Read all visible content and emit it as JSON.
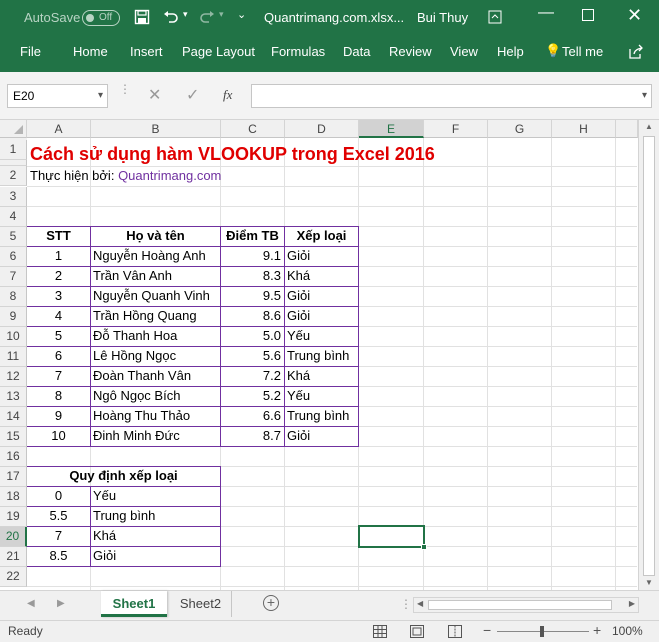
{
  "titlebar": {
    "autosave_label": "AutoSave",
    "autosave_state": "Off",
    "filename": "Quantrimang.com.xlsx...",
    "user": "Bui Thuy"
  },
  "ribbon": {
    "tabs": [
      "File",
      "Home",
      "Insert",
      "Page Layout",
      "Formulas",
      "Data",
      "Review",
      "View",
      "Help",
      "Tell me"
    ]
  },
  "formula_bar": {
    "name_box": "E20",
    "formula": "",
    "fx": "fx"
  },
  "columns": [
    "A",
    "B",
    "C",
    "D",
    "E",
    "F",
    "G",
    "H"
  ],
  "rows": [
    "1",
    "2",
    "3",
    "4",
    "5",
    "6",
    "7",
    "8",
    "9",
    "10",
    "11",
    "12",
    "13",
    "14",
    "15",
    "16",
    "17",
    "18",
    "19",
    "20",
    "21",
    "22"
  ],
  "sheet": {
    "title": "Cách sử dụng hàm VLOOKUP trong Excel 2016",
    "byline_label": "Thực hiện bởi:",
    "byline_link": "Quantrimang.com",
    "table_headers": [
      "STT",
      "Họ và tên",
      "Điểm TB",
      "Xếp loại"
    ],
    "table_rows": [
      [
        "1",
        "Nguyễn Hoàng Anh",
        "9.1",
        "Giỏi"
      ],
      [
        "2",
        "Trần Vân Anh",
        "8.3",
        "Khá"
      ],
      [
        "3",
        "Nguyễn Quanh Vinh",
        "9.5",
        "Giỏi"
      ],
      [
        "4",
        "Trần Hồng Quang",
        "8.6",
        "Giỏi"
      ],
      [
        "5",
        "Đỗ Thanh Hoa",
        "5.0",
        "Yếu"
      ],
      [
        "6",
        "Lê Hồng Ngọc",
        "5.6",
        "Trung bình"
      ],
      [
        "7",
        "Đoàn Thanh Vân",
        "7.2",
        "Khá"
      ],
      [
        "8",
        "Ngô Ngọc Bích",
        "5.2",
        "Yếu"
      ],
      [
        "9",
        "Hoàng Thu Thảo",
        "6.6",
        "Trung bình"
      ],
      [
        "10",
        "Đinh Minh Đức",
        "8.7",
        "Giỏi"
      ]
    ],
    "rule_header": "Quy định xếp loại",
    "rule_rows": [
      [
        "0",
        "Yếu"
      ],
      [
        "5.5",
        "Trung bình"
      ],
      [
        "7",
        "Khá"
      ],
      [
        "8.5",
        "Giỏi"
      ]
    ]
  },
  "sheet_tabs": [
    "Sheet1",
    "Sheet2"
  ],
  "active_sheet": "Sheet1",
  "status": {
    "text": "Ready",
    "zoom": "100%"
  },
  "colors": {
    "excel_green": "#217346",
    "title_red": "#e00000",
    "link_purple": "#7030a0",
    "border_purple": "#7030a0"
  }
}
